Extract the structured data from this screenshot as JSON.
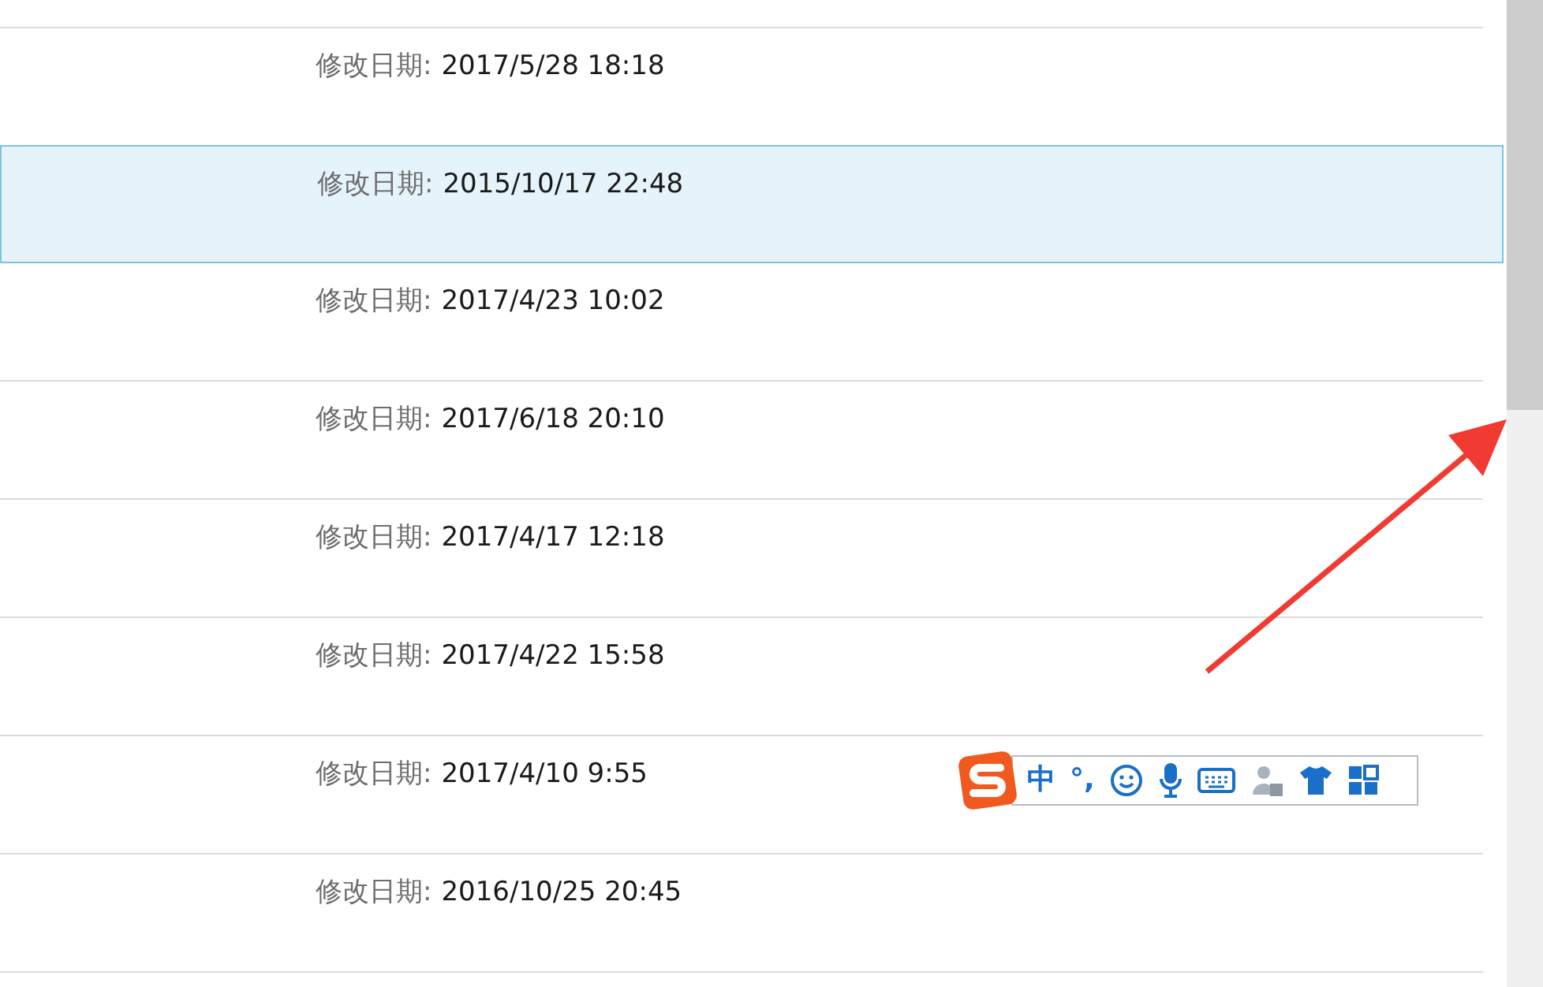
{
  "rows": [
    {
      "label": "修改日期:",
      "value": "2017/5/28 18:18",
      "selected": false
    },
    {
      "label": "修改日期:",
      "value": "2015/10/17 22:48",
      "selected": true
    },
    {
      "label": "修改日期:",
      "value": "2017/4/23 10:02",
      "selected": false
    },
    {
      "label": "修改日期:",
      "value": "2017/6/18 20:10",
      "selected": false
    },
    {
      "label": "修改日期:",
      "value": "2017/4/17 12:18",
      "selected": false
    },
    {
      "label": "修改日期:",
      "value": "2017/4/22 15:58",
      "selected": false
    },
    {
      "label": "修改日期:",
      "value": "2017/4/10 9:55",
      "selected": false
    },
    {
      "label": "修改日期:",
      "value": "2016/10/25 20:45",
      "selected": false
    }
  ],
  "ime_toolbar": {
    "mode": "中",
    "punctuation": "°,"
  }
}
